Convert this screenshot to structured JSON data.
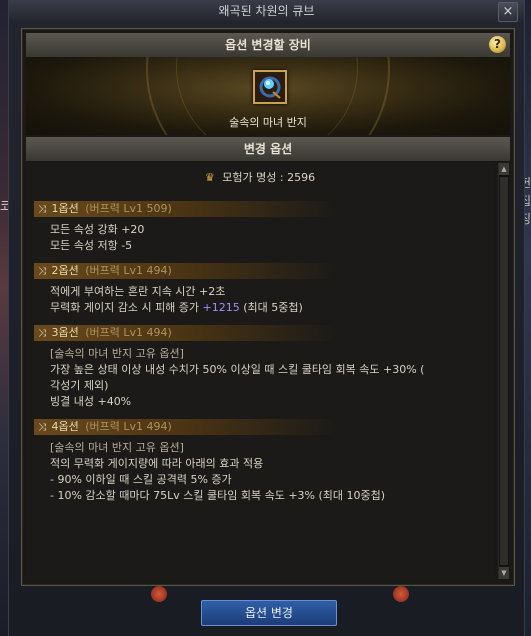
{
  "window": {
    "title": "왜곡된 차원의 큐브",
    "close_symbol": "×"
  },
  "equip_header": "옵션 변경할 장비",
  "help_symbol": "?",
  "item": {
    "name": "술속의 마녀 반지",
    "icon": "ring-icon"
  },
  "options_header": "변경 옵션",
  "fame": {
    "label": "모험가 명성 : 2596",
    "icon": "crown-icon"
  },
  "options": [
    {
      "title": "1옵션",
      "tag": "(버프력 Lv1 509)",
      "lines": [
        "모든 속성 강화 +20",
        "모든 속성 저항 -5"
      ]
    },
    {
      "title": "2옵션",
      "tag": "(버프력 Lv1 494)",
      "lines": [
        "적에게 부여하는 혼란 지속 시간 +2초"
      ],
      "line2_prefix": "무력화 게이지 감소 시 피해 증가 ",
      "line2_value": "+1215",
      "line2_suffix": " (최대 5중첩)"
    },
    {
      "title": "3옵션",
      "tag": "(버프력 Lv1 494)",
      "lines": [
        "[술속의 마녀 반지 고유 옵션]",
        "가장 높은 상태 이상 내성 수치가 50% 이상일 때 스킬 쿨타임 회복 속도 +30% (",
        "각성기 제외)",
        "빙결 내성 +40%"
      ]
    },
    {
      "title": "4옵션",
      "tag": "(버프력 Lv1 494)",
      "lines": [
        "[술속의 마녀 반지 고유 옵션]",
        "적의 무력화 게이지량에 따라 아래의 효과 적용",
        "- 90% 이하일 때 스킬 공격력 5% 증가",
        "- 10% 감소할 때마다 75Lv 스킬 쿨타임 회복 속도 +3% (최대 10중첩)"
      ]
    }
  ],
  "right_glyphs": [
    "헌",
    "집",
    "징"
  ],
  "left_glyph": "코",
  "footer_button": "옵션 변경",
  "colors": {
    "accent_gold": "#caa24b",
    "highlight_purple": "#a28cff",
    "button_blue": "#2f5fa8"
  }
}
